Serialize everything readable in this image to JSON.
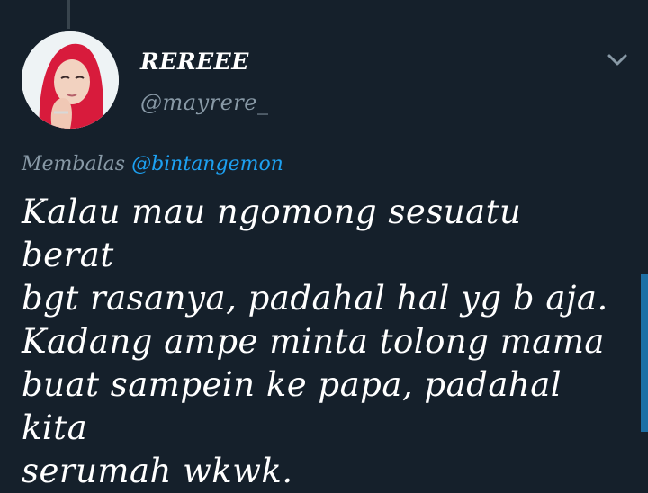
{
  "tweet": {
    "display_name": "REREEE",
    "handle": "@mayrere_",
    "reply_prefix": "Membalas",
    "reply_mention": "@bintangemon",
    "text": "Kalau mau ngomong sesuatu berat\nbgt rasanya, padahal hal yg b aja.\nKadang ampe minta tolong mama\nbuat sampein ke papa, padahal kita\nserumah wkwk."
  },
  "icons": {
    "menu": "chevron-down-icon",
    "avatar": "profile-avatar"
  },
  "colors": {
    "background": "#15202b",
    "mention": "#1da1f2",
    "secondary_text": "#8899a6",
    "scrollbar": "#1d6fa5"
  }
}
